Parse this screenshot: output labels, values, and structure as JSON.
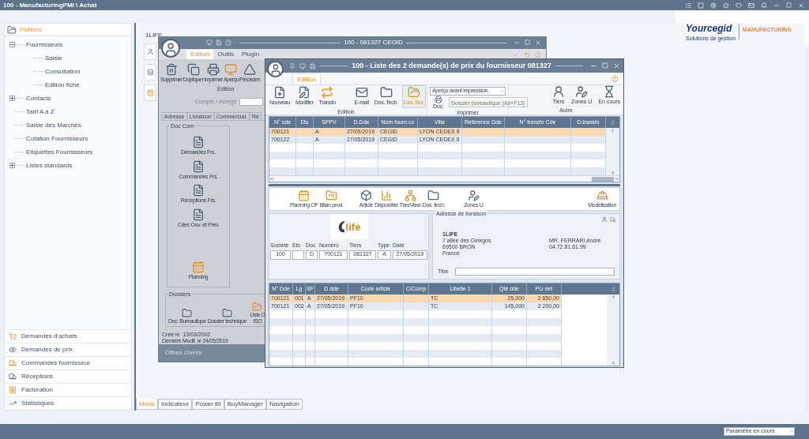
{
  "app_bar": {
    "title": "100 - ManufacturingPMI \\ Achat"
  },
  "brand": {
    "name": "Yourcegid",
    "product": "MANUFACTURING",
    "tagline": "Solutions de gestion"
  },
  "sidebar": {
    "header": "Fichiers",
    "tree": [
      {
        "label": "Fournisseurs",
        "expanded": true,
        "children": [
          {
            "label": "Saisie"
          },
          {
            "label": "Consultation"
          },
          {
            "label": "Edition fiche"
          }
        ]
      },
      {
        "label": "Contacts",
        "expanded": false
      },
      {
        "label": "Tarif A à Z"
      },
      {
        "label": "Saisie des Marchés"
      },
      {
        "label": "Cotation Fournisseurs"
      },
      {
        "label": "Etiquettes Fournisseurs"
      },
      {
        "label": "Listes standards",
        "expanded": false
      }
    ],
    "modules": [
      {
        "label": "Demandes d'achats"
      },
      {
        "label": "Demandes de prix"
      },
      {
        "label": "Commandes fournisseur"
      },
      {
        "label": "Réceptions"
      },
      {
        "label": "Facturation"
      },
      {
        "label": "Statistiques"
      }
    ]
  },
  "workspace": {
    "title": "1LIFE",
    "tabs": [
      {
        "label": "Menu",
        "selected": true
      },
      {
        "label": "Indicateur",
        "selected": false
      },
      {
        "label": "Power BI",
        "selected": false
      },
      {
        "label": "BuyManager",
        "selected": false
      },
      {
        "label": "Navigation",
        "selected": false
      }
    ]
  },
  "back_window": {
    "title": "100 - 081327 CEGID",
    "tabs": [
      {
        "label": "Edition",
        "selected": true
      },
      {
        "label": "Outils",
        "selected": false
      },
      {
        "label": "Plugin",
        "selected": false
      }
    ],
    "toolbar": [
      "Supprimer",
      "Dupliquer",
      "Imprimer",
      "Aperçu",
      "Précéden"
    ],
    "toolbar_group": "Edition",
    "account_label": "Compte / Abrégé",
    "sections": [
      "Adresse",
      "Livraison",
      "Commercial.",
      "Ré"
    ],
    "doc_com": {
      "title": "Doc Com",
      "items": [
        "Demandes Frs.",
        "Commandes Frs.",
        "Réceptions Frs.",
        "Cdes Ouv. et Prev.",
        "Planning"
      ]
    },
    "dossiers": {
      "title": "Dossiers",
      "items": [
        "Doc. Bureautique",
        "Dossier technique",
        "Liste D ISO"
      ]
    },
    "created": "Créé le  13/03/2002",
    "modified": "Dernière Modif. le 24/05/2019",
    "footer": "Offres clients"
  },
  "front_window": {
    "title": "100 - Liste des 2 demande(s) de prix du fournisseur 081327",
    "tabs": [
      {
        "label": "Edition",
        "selected": true
      }
    ],
    "edition_group": {
      "label": "Edition",
      "buttons": [
        {
          "label": "Nouveau",
          "highlighted": false
        },
        {
          "label": "Modifier",
          "highlighted": false
        },
        {
          "label": "Transfo",
          "highlighted": false
        },
        {
          "label": "E-mail",
          "highlighted": false
        },
        {
          "label": "Dos. Tech.",
          "highlighted": false
        },
        {
          "label": "Dos. Bur.",
          "highlighted": true
        }
      ]
    },
    "print_group": {
      "label": "Imprimer",
      "select": "Aperçu avant impression.",
      "button": "Doc."
    },
    "other_group": {
      "label": "Autre",
      "buttons": [
        "Tiers",
        "Zones U",
        "En cours"
      ]
    },
    "tooltip": "Dossier bureautique (Alt+F12)",
    "grid": {
      "columns": [
        "N° cde",
        "Ets",
        "SFPV",
        "D.Dde",
        "Nom fourn co",
        "Ville",
        "Référence Dde",
        "N° transfo Cde",
        "D.transfo"
      ],
      "rows": [
        {
          "selected": true,
          "cells": [
            "700121",
            null,
            "A",
            "27/05/2019",
            "CEGID",
            "LYON CEDEX 9",
            null,
            null,
            null
          ]
        },
        {
          "selected": false,
          "cells": [
            "700122",
            null,
            "A",
            "27/05/2019",
            "CEGID",
            "LYON CEDEX 9",
            null,
            null,
            null
          ]
        }
      ]
    },
    "actions": [
      "Planning OF",
      "Bilan prod.",
      "Article",
      "Disponible",
      "TreeView",
      "Dos. tech.",
      "Zones U",
      "Modelisation"
    ],
    "header": {
      "logo": "life",
      "fields": [
        {
          "label": "Société",
          "value": "100"
        },
        {
          "label": "Ets"
        },
        {
          "label": "Doc",
          "value": "D"
        },
        {
          "label": "Numéro",
          "value": "700121"
        },
        {
          "label": "Tiers",
          "value": "081327"
        },
        {
          "label": "Type",
          "value": "A"
        },
        {
          "label": "Date",
          "value": "27/05/2019"
        }
      ],
      "address": {
        "title": "Adresse de livraison",
        "lines": [
          "1LIFE",
          "7 allée des Ginkgos",
          "69500 BRON",
          "France"
        ],
        "contact": [
          "MR. FERRARI André",
          "04.72.81.61.99"
        ],
        "title_label": "Titre"
      }
    },
    "lines": {
      "columns": [
        "N° Dde",
        "Lg",
        "SF",
        "D dde",
        "Code article",
        "C/Comp",
        "Libelle 1",
        "Qté dde",
        "PU net"
      ],
      "rows": [
        {
          "selected": true,
          "cells": [
            "700121",
            "001",
            "A",
            "27/05/2019",
            "PF10",
            null,
            "TC",
            "25,000",
            "2 850,00"
          ]
        },
        {
          "selected": false,
          "cells": [
            "700121",
            "002",
            "A",
            "27/05/2019",
            "PF10",
            null,
            "TC",
            "145,000",
            "2 200,00"
          ]
        }
      ]
    }
  },
  "status_bar": {
    "select": "Paramètre en cours"
  }
}
